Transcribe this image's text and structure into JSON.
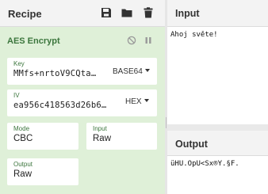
{
  "recipe": {
    "title": "Recipe",
    "icons": [
      "save-icon",
      "folder-icon",
      "trash-icon"
    ]
  },
  "operation": {
    "name": "AES Encrypt",
    "icons": [
      "disable-icon",
      "pause-icon"
    ],
    "key": {
      "label": "Key",
      "value": "MMfs+nrtoV9CQta…",
      "format": "BASE64"
    },
    "iv": {
      "label": "IV",
      "value": "ea956c418563d26b6…",
      "format": "HEX"
    },
    "mode": {
      "label": "Mode",
      "value": "CBC"
    },
    "input": {
      "label": "Input",
      "value": "Raw"
    },
    "output": {
      "label": "Output",
      "value": "Raw"
    }
  },
  "input_pane": {
    "title": "Input",
    "text": "Ahoj světe!"
  },
  "output_pane": {
    "title": "Output",
    "text": "üHÜ.ÕpÜ<Sx®Ý.§F."
  },
  "colors": {
    "operation_bg": "#dff0d8",
    "operation_text": "#3c763d"
  }
}
